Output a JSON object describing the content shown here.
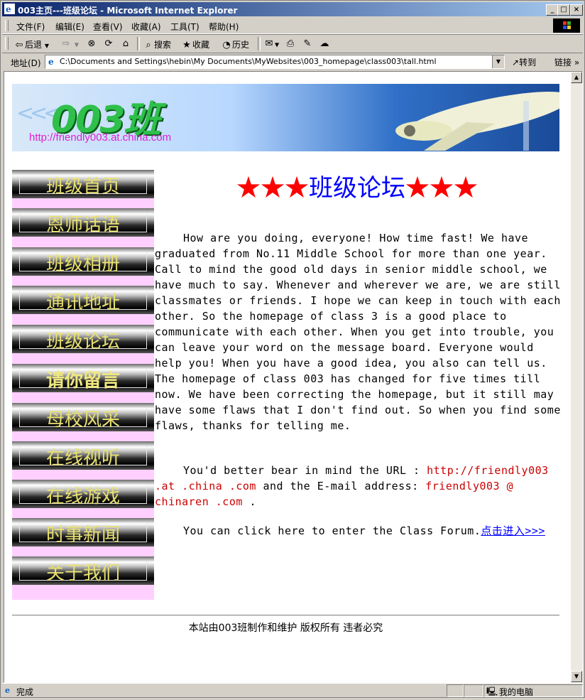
{
  "window": {
    "title": "003主页---班级论坛 - Microsoft Internet Explorer",
    "minimize": "_",
    "maximize": "□",
    "close": "×"
  },
  "menu": {
    "items": [
      "文件(F)",
      "编辑(E)",
      "查看(V)",
      "收藏(A)",
      "工具(T)",
      "帮助(H)"
    ]
  },
  "toolbar": {
    "back": "后退",
    "search": "搜索",
    "favorites": "收藏",
    "history": "历史"
  },
  "address": {
    "label": "地址(D)",
    "value": "C:\\Documents and Settings\\hebin\\My Documents\\MyWebsites\\003_homepage\\class003\\tall.html",
    "go": "转到",
    "links": "链接"
  },
  "banner": {
    "logo": "003班",
    "url": "http://friendly003.at.china.com"
  },
  "nav": {
    "items": [
      {
        "label": "班级首页"
      },
      {
        "label": "恩师话语"
      },
      {
        "label": "班级相册"
      },
      {
        "label": "通讯地址"
      },
      {
        "label": "班级论坛"
      },
      {
        "label": "请你留言"
      },
      {
        "label": "母校风采"
      },
      {
        "label": "在线视听"
      },
      {
        "label": "在线游戏"
      },
      {
        "label": "时事新闻"
      },
      {
        "label": "关于我们"
      }
    ]
  },
  "page": {
    "heading_stars_left": "★★★",
    "heading_text": "班级论坛",
    "heading_stars_right": "★★★",
    "para1": "How are you doing, everyone! How time fast! We have graduated from No.11 Middle School for more than one year. Call to mind the good old days in senior middle school, we have much to say. Whenever and wherever we are, we are still classmates or friends. I hope we can keep in touch with each other. So the homepage of class 3 is a good place to communicate with each other. When you get into trouble, you can leave your word on the message board. Everyone would help you! When you have a good idea, you also can tell us. The homepage of class 003 has changed for five times till now. We have been correcting the homepage, but it still may have some flaws that I don't find out. So when you find some flaws, thanks for telling me.",
    "para2_a": "You'd better bear in mind the URL :",
    "para2_url": "http://friendly003 .at .china .com",
    "para2_b": "and the E-mail address:",
    "para2_email": "friendly003 @ chinaren .com",
    "para2_c": ".",
    "para3_text": "You can click here to enter the Class Forum.",
    "para3_link": "点击进入>>>",
    "footer": "本站由003班制作和维护 版权所有 违者必究"
  },
  "status": {
    "text": "完成",
    "zone": "我的电脑"
  }
}
